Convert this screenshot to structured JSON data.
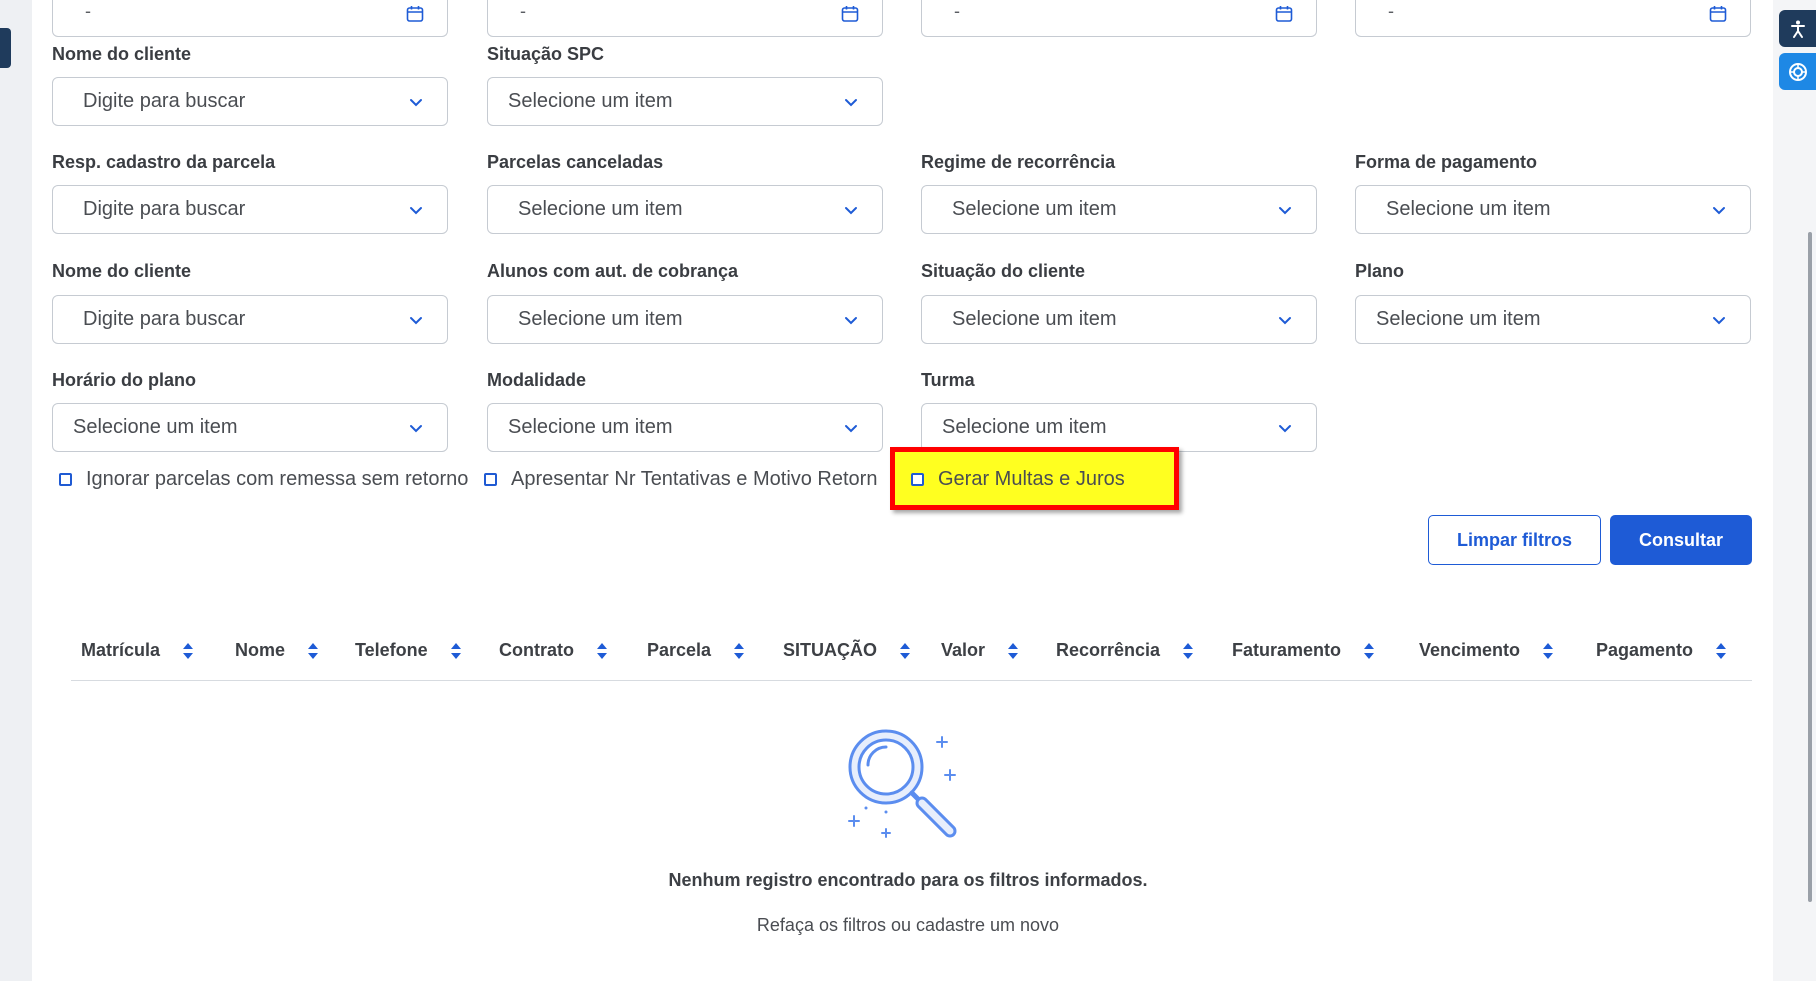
{
  "date_fields": [
    {
      "value": "-"
    },
    {
      "value": "-"
    },
    {
      "value": "-"
    },
    {
      "value": "-"
    }
  ],
  "filters": {
    "nome_cliente_1": {
      "label": "Nome do cliente",
      "value": "Digite para buscar"
    },
    "situacao_spc": {
      "label": "Situação SPC",
      "value": "Selecione um item"
    },
    "resp_cadastro": {
      "label": "Resp. cadastro da parcela",
      "value": "Digite para buscar"
    },
    "parcelas_canceladas": {
      "label": "Parcelas canceladas",
      "value": "Selecione um item"
    },
    "regime_recorrencia": {
      "label": "Regime de recorrência",
      "value": "Selecione um item"
    },
    "forma_pagamento": {
      "label": "Forma de pagamento",
      "value": "Selecione um item"
    },
    "nome_cliente_2": {
      "label": "Nome do cliente",
      "value": "Digite para buscar"
    },
    "alunos_aut_cobranca": {
      "label": "Alunos com aut. de cobrança",
      "value": "Selecione um item"
    },
    "situacao_cliente": {
      "label": "Situação do cliente",
      "value": "Selecione um item"
    },
    "plano": {
      "label": "Plano",
      "value": "Selecione um item"
    },
    "horario_plano": {
      "label": "Horário do plano",
      "value": "Selecione um item"
    },
    "modalidade": {
      "label": "Modalidade",
      "value": "Selecione um item"
    },
    "turma": {
      "label": "Turma",
      "value": "Selecione um item"
    }
  },
  "checkboxes": {
    "ignorar": "Ignorar parcelas com remessa sem retorno",
    "apresentar": "Apresentar Nr Tentativas e Motivo Retorn",
    "gerar_multas": "Gerar Multas e Juros"
  },
  "buttons": {
    "limpar": "Limpar filtros",
    "consultar": "Consultar"
  },
  "table": {
    "columns": [
      "Matrícula",
      "Nome",
      "Telefone",
      "Contrato",
      "Parcela",
      "SITUAÇÃO",
      "Valor",
      "Recorrência",
      "Faturamento",
      "Vencimento",
      "Pagamento"
    ]
  },
  "empty_state": {
    "title": "Nenhum registro encontrado para os filtros informados.",
    "subtitle": "Refaça os filtros ou cadastre um novo"
  },
  "colors": {
    "primary": "#1e5bd6",
    "highlight_border": "#ff0000",
    "highlight_fill": "#ffff20",
    "rail_dark": "#1f3b5c",
    "rail_blue": "#1e88e5"
  },
  "icons": [
    "calendar-icon",
    "chevron-down-icon",
    "sort-icon",
    "magnifier-illustration-icon",
    "accessibility-icon",
    "chat-assistant-icon"
  ]
}
